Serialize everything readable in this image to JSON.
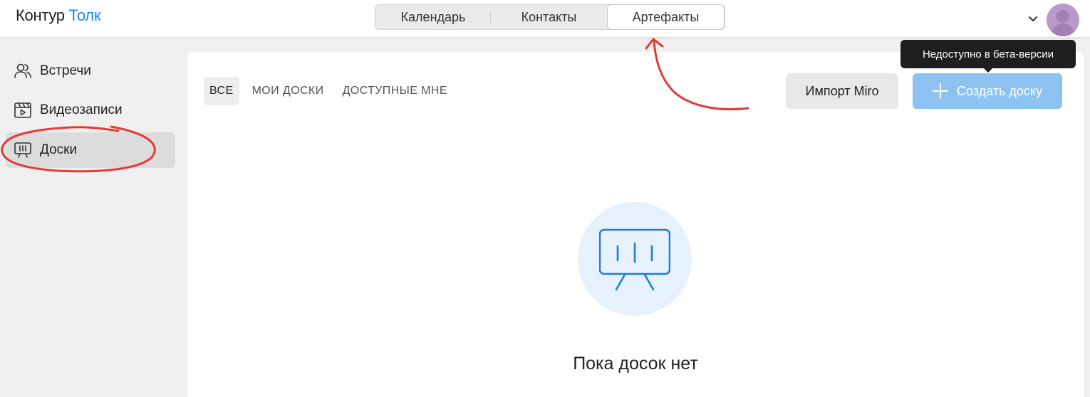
{
  "header": {
    "logo_brand": "Контур",
    "logo_product": "Толк",
    "tabs": [
      {
        "label": "Календарь"
      },
      {
        "label": "Контакты"
      },
      {
        "label": "Артефакты",
        "active": true
      }
    ]
  },
  "sidebar": {
    "items": [
      {
        "label": "Встречи",
        "icon": "people-icon"
      },
      {
        "label": "Видеозаписи",
        "icon": "video-clapper-icon"
      },
      {
        "label": "Доски",
        "icon": "board-icon",
        "active": true
      }
    ]
  },
  "main": {
    "filters": [
      {
        "label": "ВСЕ",
        "active": true
      },
      {
        "label": "МОИ ДОСКИ"
      },
      {
        "label": "ДОСТУПНЫЕ МНЕ"
      }
    ],
    "import_label": "Импорт Miro",
    "create_label": "Создать доску",
    "tooltip": "Недоступно в бета-версии",
    "empty_text": "Пока досок нет"
  },
  "colors": {
    "accent": "#1f87ef",
    "create_button_disabled": "#8ec3f1",
    "annotation_red": "#e53935",
    "empty_circle": "#e6f1fc"
  }
}
